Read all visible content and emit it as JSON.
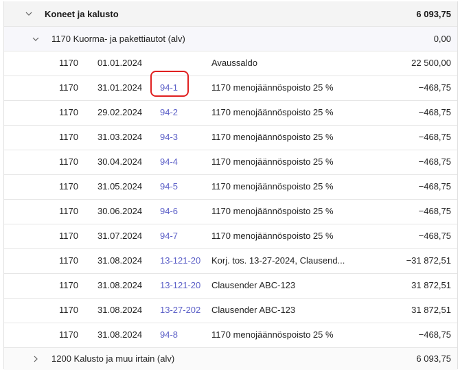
{
  "group": {
    "label": "Koneet ja kalusto",
    "total": "6 093,75"
  },
  "account_1170": {
    "label": "1170 Kuorma- ja pakettiautot (alv)",
    "total": "0,00"
  },
  "rows": [
    {
      "acct": "1170",
      "date": "01.01.2024",
      "doc": "",
      "desc": "Avaussaldo",
      "amount": "22 500,00"
    },
    {
      "acct": "1170",
      "date": "31.01.2024",
      "doc": "94-1",
      "desc": "1170 menojäännöspoisto 25 %",
      "amount": "−468,75"
    },
    {
      "acct": "1170",
      "date": "29.02.2024",
      "doc": "94-2",
      "desc": "1170 menojäännöspoisto 25 %",
      "amount": "−468,75"
    },
    {
      "acct": "1170",
      "date": "31.03.2024",
      "doc": "94-3",
      "desc": "1170 menojäännöspoisto 25 %",
      "amount": "−468,75"
    },
    {
      "acct": "1170",
      "date": "30.04.2024",
      "doc": "94-4",
      "desc": "1170 menojäännöspoisto 25 %",
      "amount": "−468,75"
    },
    {
      "acct": "1170",
      "date": "31.05.2024",
      "doc": "94-5",
      "desc": "1170 menojäännöspoisto 25 %",
      "amount": "−468,75"
    },
    {
      "acct": "1170",
      "date": "30.06.2024",
      "doc": "94-6",
      "desc": "1170 menojäännöspoisto 25 %",
      "amount": "−468,75"
    },
    {
      "acct": "1170",
      "date": "31.07.2024",
      "doc": "94-7",
      "desc": "1170 menojäännöspoisto 25 %",
      "amount": "−468,75"
    },
    {
      "acct": "1170",
      "date": "31.08.2024",
      "doc": "13-121-20",
      "desc": "Korj. tos. 13-27-2024, Clausend...",
      "amount": "−31 872,51"
    },
    {
      "acct": "1170",
      "date": "31.08.2024",
      "doc": "13-121-20",
      "desc": "Clausender ABC-123",
      "amount": "31 872,51"
    },
    {
      "acct": "1170",
      "date": "31.08.2024",
      "doc": "13-27-202",
      "desc": "Clausender ABC-123",
      "amount": "31 872,51"
    },
    {
      "acct": "1170",
      "date": "31.08.2024",
      "doc": "94-8",
      "desc": "1170 menojäännöspoisto 25 %",
      "amount": "−468,75"
    }
  ],
  "account_1200": {
    "label": "1200 Kalusto ja muu irtain (alv)",
    "total": "6 093,75"
  },
  "icons": {
    "expanded": "chevron-down-icon",
    "collapsed": "chevron-right-icon"
  },
  "colors": {
    "link": "#5b5fc7",
    "highlight": "#e02020"
  }
}
